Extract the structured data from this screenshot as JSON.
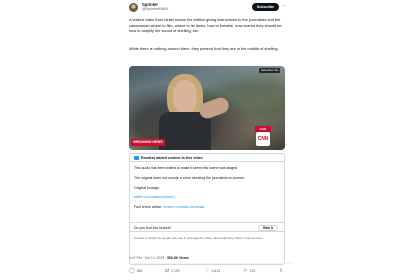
{
  "tweet": {
    "author_name": "Sprinter",
    "author_handle": "@Sprinter99800",
    "subscribe_label": "Subscribe",
    "more_icon": "more-icon",
    "paragraph_1": "A leaked video from Israel shows the edition giving instructions to the journalists and the cameraman where to film, where to lie down, how to breathe, how scared they should be, how to amplify the sound of shelling, etc.",
    "paragraph_2": "While there is nothing around them, they pretend that they are in the middle of shelling.",
    "media": {
      "corner_tag": "Subscriber Info",
      "banner": "BREAKING NEWS",
      "live_badge": "LIVE",
      "network_logo": "CNN"
    },
    "community_note": {
      "title": "Readers added context to this video",
      "line_1": "This audio has been edited to make it seem this scene was staged.",
      "line_2": "The original does not include a voice directing the journalists on screen.",
      "line_3": "Original footage:",
      "link_1": "twitter.com/ralleoy/works/1...",
      "line_4": "Fact check article:",
      "link_2": "reuters.com/fact-check/fak...",
      "helpful_question": "Do you find this helpful?",
      "rate_label": "Rate it",
      "footer": "Context is written by people who use X, and appears when rated helpful by others. Find out more."
    },
    "time": "4:47 PM · Oct 13, 2023 ·",
    "views": "500.3K Views",
    "actions": {
      "replies": "368",
      "retweets": "2,150",
      "likes": "4,813",
      "bookmarks": "125"
    }
  }
}
